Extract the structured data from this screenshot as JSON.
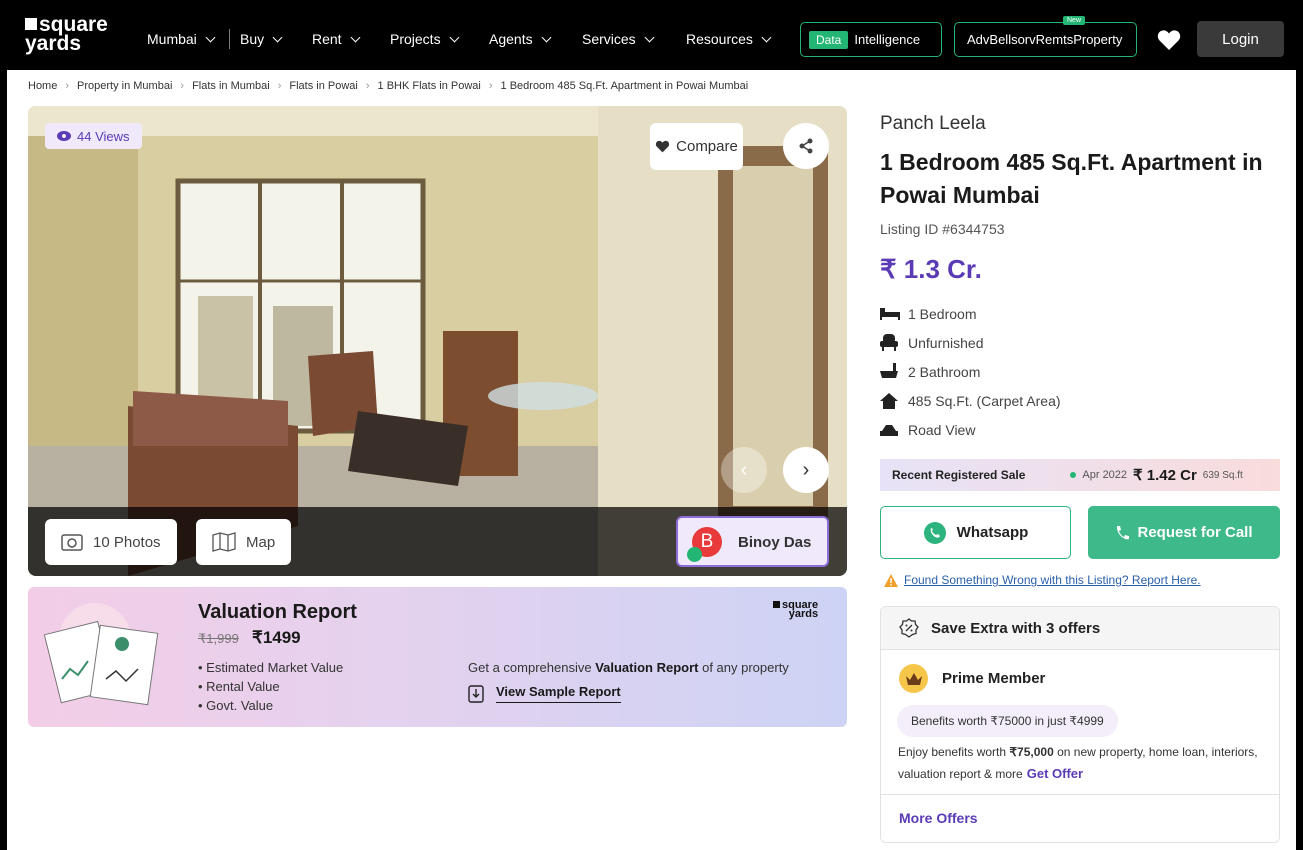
{
  "nav": {
    "logo_line1": "square",
    "logo_line2": "yards",
    "city": "Mumbai",
    "items": [
      "Buy",
      "Rent",
      "Projects",
      "Agents",
      "Services",
      "Resources"
    ],
    "data_tag": "Data",
    "intelligence": "Intelligence",
    "post_property": "AdvBellsorvRemtsProperty",
    "new_tag": "New",
    "login": "Login"
  },
  "breadcrumb": [
    "Home",
    "Property in Mumbai",
    "Flats in Mumbai",
    "Flats in Powai",
    "1 BHK Flats in Powai",
    "1 Bedroom 485 Sq.Ft. Apartment in Powai Mumbai"
  ],
  "gallery": {
    "views": "44 Views",
    "compare": "Compare",
    "photos": "10 Photos",
    "map": "Map",
    "agent_initial": "B",
    "agent_name": "Binoy Das"
  },
  "valuation": {
    "title": "Valuation Report",
    "old_price": "₹1,999",
    "new_price": "₹1499",
    "points": [
      "Estimated Market Value",
      "Rental Value",
      "Govt. Value"
    ],
    "desc_prefix": "Get a comprehensive ",
    "desc_bold": "Valuation Report",
    "desc_suffix": " of any property",
    "sample_link": "View Sample Report",
    "logo_line1": "square",
    "logo_line2": "yards"
  },
  "listing": {
    "project": "Panch Leela",
    "title": "1 Bedroom 485 Sq.Ft. Apartment in Powai Mumbai",
    "listing_id": "Listing ID #6344753",
    "price": "₹ 1.3 Cr.",
    "features": [
      {
        "icon": "bed-icon",
        "label": "1 Bedroom"
      },
      {
        "icon": "armchair-icon",
        "label": "Unfurnished"
      },
      {
        "icon": "bathtub-icon",
        "label": "2 Bathroom"
      },
      {
        "icon": "home-icon",
        "label": "485 Sq.Ft. (Carpet Area)"
      },
      {
        "icon": "road-view-icon",
        "label": "Road View"
      }
    ]
  },
  "recent_sale": {
    "label": "Recent Registered Sale",
    "date": "Apr 2022",
    "amount": "₹ 1.42 Cr",
    "per_sqft": "639 Sq.ft"
  },
  "actions": {
    "whatsapp": "Whatsapp",
    "call": "Request for Call",
    "report": "Found Something Wrong with this Listing? Report Here."
  },
  "offers": {
    "header": "Save Extra with 3 offers",
    "prime": "Prime Member",
    "benefit_chip": "Benefits worth ₹75000 in just ₹4999",
    "enjoy_prefix": "Enjoy benefits worth ",
    "enjoy_bold": "₹75,000",
    "enjoy_suffix": " on new property, home loan, interiors, valuation report & more",
    "get_offer": "Get Offer",
    "more": "More Offers"
  },
  "colors": {
    "brand_purple": "#5b3bb5",
    "green": "#22b573",
    "call_green": "#3db98a",
    "nav_black": "#000000"
  }
}
